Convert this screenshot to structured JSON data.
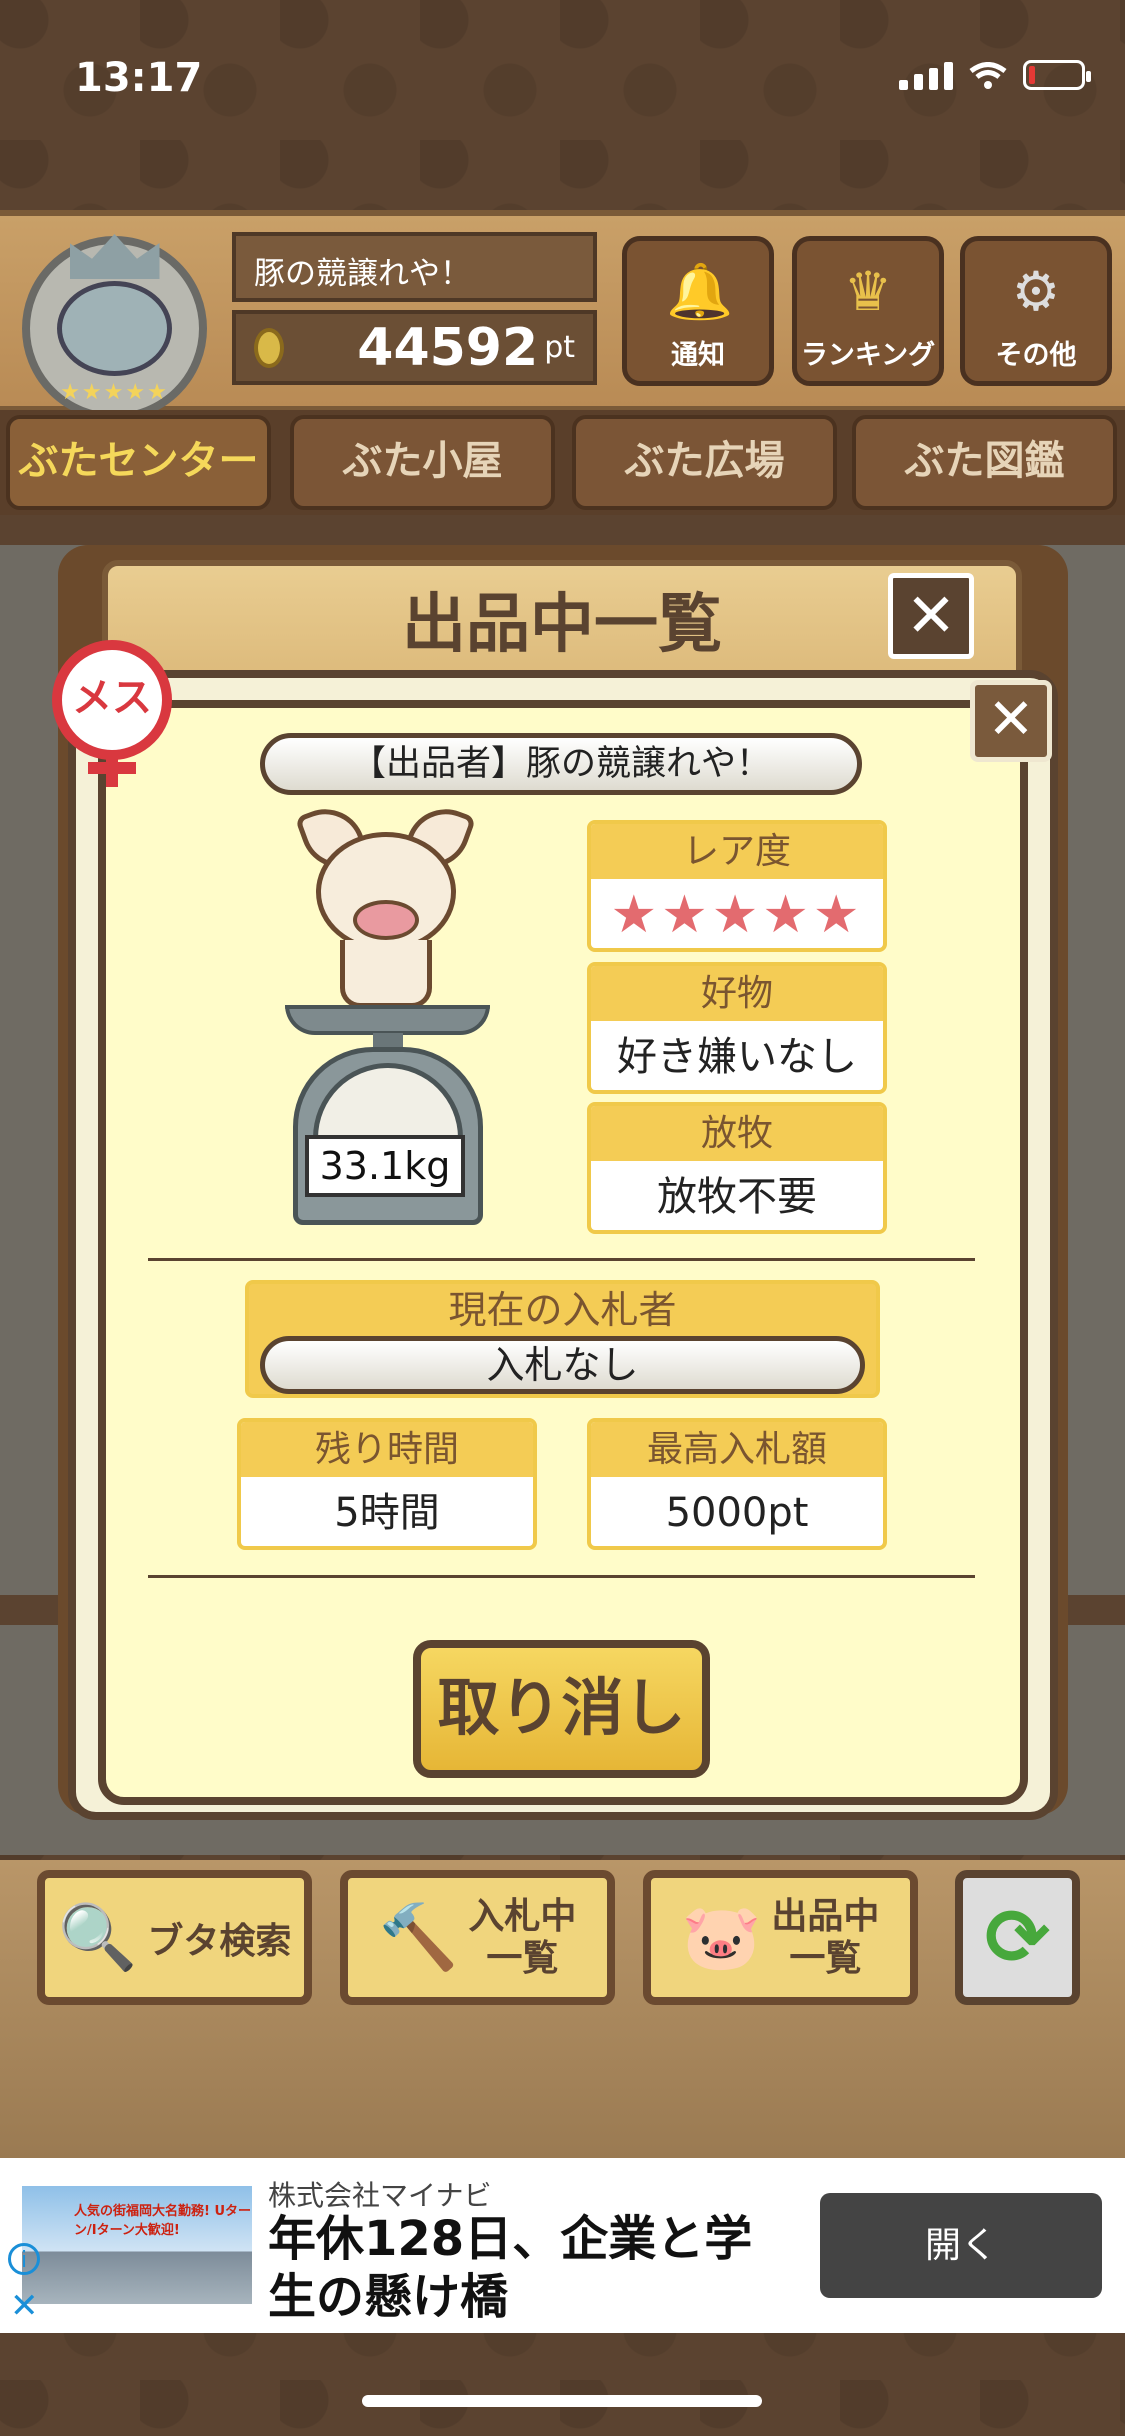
{
  "status_bar": {
    "time": "13:17"
  },
  "header": {
    "user_name": "豚の競譲れや！",
    "points": "44592",
    "points_unit": "pt",
    "buttons": [
      {
        "label": "通知",
        "icon": "bell-icon"
      },
      {
        "label": "ランキング",
        "icon": "crown-icon"
      },
      {
        "label": "その他",
        "icon": "gear-icon"
      }
    ]
  },
  "tabs": [
    {
      "label": "ぶたセンター",
      "active": true
    },
    {
      "label": "ぶた小屋"
    },
    {
      "label": "ぶた広場"
    },
    {
      "label": "ぶた図鑑"
    }
  ],
  "list_panel": {
    "title": "出品中一覧"
  },
  "detail": {
    "gender": "メス",
    "seller": "【出品者】豚の競譲れや！",
    "weight": "33.1kg",
    "rarity": {
      "label": "レア度",
      "stars": "★★★★★"
    },
    "favorite": {
      "label": "好物",
      "value": "好き嫌いなし"
    },
    "grazing": {
      "label": "放牧",
      "value": "放牧不要"
    },
    "current_bidder": {
      "label": "現在の入札者",
      "value": "入札なし"
    },
    "time_left": {
      "label": "残り時間",
      "value": "5時間"
    },
    "highest_bid": {
      "label": "最高入札額",
      "value": "5000pt"
    },
    "cancel_label": "取り消し"
  },
  "toolbar": {
    "search": "ブタ検索",
    "bidding_line1": "入札中",
    "bidding_line2": "一覧",
    "listing_line1": "出品中",
    "listing_line2": "一覧"
  },
  "ad": {
    "company": "株式会社マイナビ",
    "headline": "年休128日、企業と学生の懸け橋",
    "button": "開く",
    "image_caption": "人気の街福岡大名勤務! Uターン/Iターン大歓迎!"
  },
  "colors": {
    "accent_yellow": "#f4cc55",
    "wood_dark": "#5a4330",
    "star_pink": "#e36b6f",
    "gender_red": "#d9383f"
  }
}
